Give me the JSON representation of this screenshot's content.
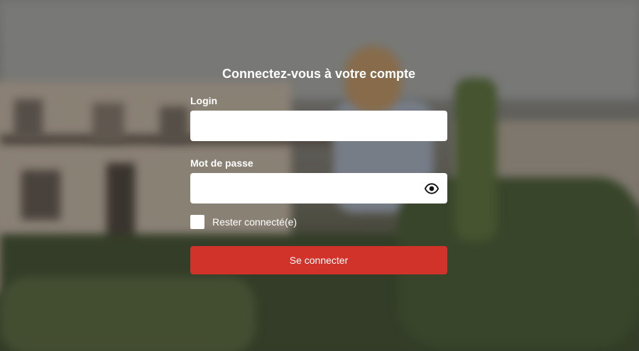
{
  "login_form": {
    "title": "Connectez-vous à votre compte",
    "login": {
      "label": "Login",
      "value": "",
      "placeholder": ""
    },
    "password": {
      "label": "Mot de passe",
      "value": "",
      "placeholder": "",
      "toggle_icon": "eye-icon"
    },
    "remember_me": {
      "label": "Rester connecté(e)",
      "checked": false
    },
    "submit_label": "Se connecter"
  },
  "colors": {
    "accent": "#d1332b",
    "text": "#ffffff",
    "input_bg": "#ffffff"
  }
}
